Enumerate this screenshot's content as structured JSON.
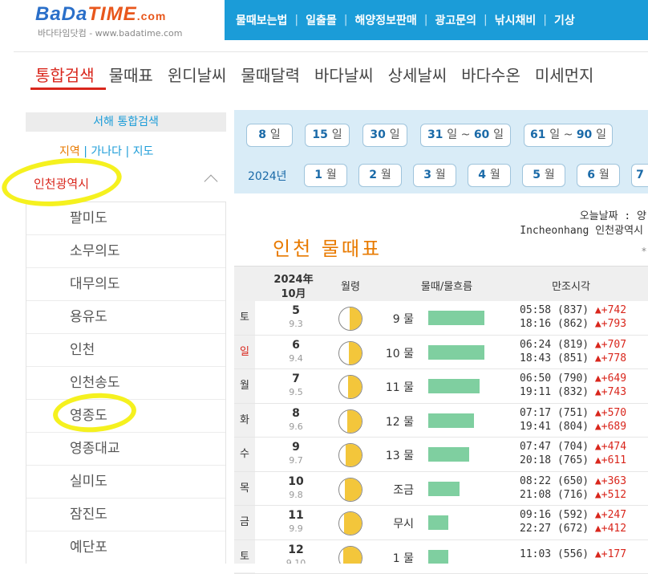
{
  "header": {
    "logo_bada": "BaDa",
    "logo_time": "TIME",
    "logo_com": ".com",
    "logo_sub": "바다타임닷컴 - www.badatime.com",
    "nav": [
      "물때보는법",
      "일출몰",
      "해양정보판매",
      "광고문의",
      "낚시채비",
      "기상"
    ]
  },
  "tabs": [
    "통합검색",
    "물때표",
    "윈디날씨",
    "물때달력",
    "바다날씨",
    "상세날씨",
    "바다수온",
    "미세먼지"
  ],
  "sidebar": {
    "heading": "서해 통합검색",
    "filter_region": "지역",
    "filter_sep": "|",
    "filter_ganada": "가나다",
    "filter_map": "지도",
    "selected_region": "인천광역시",
    "items": [
      "팔미도",
      "소무의도",
      "대무의도",
      "용유도",
      "인천",
      "인천송도",
      "영종도",
      "영종대교",
      "실미도",
      "잠진도",
      "예단포"
    ]
  },
  "day_buttons": [
    {
      "num": "8",
      "unit": "일"
    },
    {
      "num": "15",
      "unit": "일"
    },
    {
      "num": "30",
      "unit": "일"
    },
    {
      "num": "31",
      "mid": "일 ~ ",
      "num2": "60",
      "unit": "일"
    },
    {
      "num": "61",
      "mid": "일 ~ ",
      "num2": "90",
      "unit": "일"
    }
  ],
  "year_label": "2024년",
  "month_buttons": [
    {
      "num": "1",
      "unit": "월"
    },
    {
      "num": "2",
      "unit": "월"
    },
    {
      "num": "3",
      "unit": "월"
    },
    {
      "num": "4",
      "unit": "월"
    },
    {
      "num": "5",
      "unit": "월"
    },
    {
      "num": "6",
      "unit": "월"
    },
    {
      "num": "7",
      "unit": ""
    }
  ],
  "info": {
    "today_label": "오늘날짜 : 양",
    "port_label": "Incheonhang 인천광역시",
    "asterisk": "*"
  },
  "page_title": "인천 물때표",
  "table": {
    "col_date_year": "2024年",
    "col_date_month": "10月",
    "col_moon": "월령",
    "col_tide": "물때/물흐름",
    "col_high": "만조시각",
    "rows": [
      {
        "dow": "토",
        "red": false,
        "day": "5",
        "lunar": "9.3",
        "mul": "9 물",
        "flow": 0.64,
        "phase": 0.08,
        "t1": "05:58 (837)",
        "d1": "▲+742",
        "t2": "18:16 (862)",
        "d2": "▲+793"
      },
      {
        "dow": "일",
        "red": true,
        "day": "6",
        "lunar": "9.4",
        "mul": "10 물",
        "flow": 0.64,
        "phase": 0.16,
        "t1": "06:24 (819)",
        "d1": "▲+707",
        "t2": "18:43 (851)",
        "d2": "▲+778"
      },
      {
        "dow": "월",
        "red": false,
        "day": "7",
        "lunar": "9.5",
        "mul": "11 물",
        "flow": 0.58,
        "phase": 0.24,
        "t1": "06:50 (790)",
        "d1": "▲+649",
        "t2": "19:11 (832)",
        "d2": "▲+743"
      },
      {
        "dow": "화",
        "red": false,
        "day": "8",
        "lunar": "9.6",
        "mul": "12 물",
        "flow": 0.52,
        "phase": 0.32,
        "t1": "07:17 (751)",
        "d1": "▲+570",
        "t2": "19:41 (804)",
        "d2": "▲+689"
      },
      {
        "dow": "수",
        "red": false,
        "day": "9",
        "lunar": "9.7",
        "mul": "13 물",
        "flow": 0.46,
        "phase": 0.42,
        "t1": "07:47 (704)",
        "d1": "▲+474",
        "t2": "20:18 (765)",
        "d2": "▲+611"
      },
      {
        "dow": "목",
        "red": false,
        "day": "10",
        "lunar": "9.8",
        "mul": "조금",
        "flow": 0.35,
        "phase": 0.5,
        "t1": "08:22 (650)",
        "d1": "▲+363",
        "t2": "21:08 (716)",
        "d2": "▲+512"
      },
      {
        "dow": "금",
        "red": false,
        "day": "11",
        "lunar": "9.9",
        "mul": "무시",
        "flow": 0.23,
        "phase": 0.58,
        "t1": "09:16 (592)",
        "d1": "▲+247",
        "t2": "22:27 (672)",
        "d2": "▲+412"
      },
      {
        "dow": "토",
        "red": false,
        "day": "12",
        "lunar": "9.10",
        "mul": "1 물",
        "flow": 0.23,
        "phase": 0.66,
        "t1": "11:03 (556)",
        "d1": "▲+177",
        "t2": "",
        "d2": ""
      }
    ]
  },
  "colors": {
    "accent": "#1b9cd8",
    "red": "#d9261c",
    "orange": "#e87a00",
    "bar": "#7fcfa0",
    "moon": "#f3c63b",
    "highlight": "#f5f11f"
  }
}
